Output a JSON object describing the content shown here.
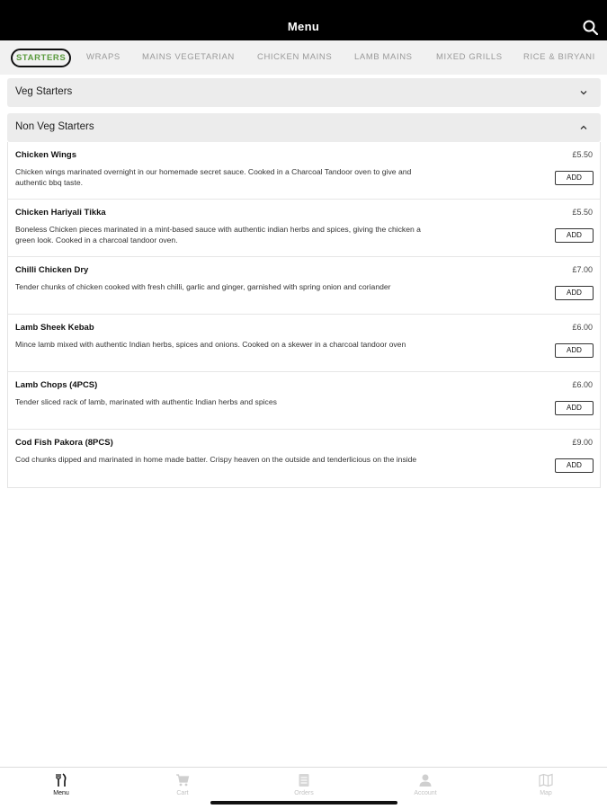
{
  "header": {
    "title": "Menu",
    "search_icon": "search-icon"
  },
  "tabs": [
    {
      "label": "STARTERS",
      "active": true
    },
    {
      "label": "WRAPS"
    },
    {
      "label": "MAINS VEGETARIAN"
    },
    {
      "label": "CHICKEN MAINS"
    },
    {
      "label": "LAMB MAINS"
    },
    {
      "label": "MIXED GRILLS"
    },
    {
      "label": "RICE & BIRYANI"
    }
  ],
  "sections": {
    "veg": {
      "label": "Veg Starters",
      "expanded": false
    },
    "nonveg": {
      "label": "Non Veg Starters",
      "expanded": true
    }
  },
  "items": [
    {
      "name": "Chicken Wings",
      "price": "£5.50",
      "desc": "Chicken wings marinated overnight in our homemade secret sauce. Cooked in a Charcoal Tandoor oven to give and authentic bbq taste.",
      "add": "ADD"
    },
    {
      "name": "Chicken Hariyali Tikka",
      "price": "£5.50",
      "desc": "Boneless Chicken pieces marinated in a mint-based sauce with authentic indian herbs and spices, giving the chicken a green look. Cooked in a charcoal tandoor oven.",
      "add": "ADD"
    },
    {
      "name": "Chilli Chicken Dry",
      "price": "£7.00",
      "desc": "Tender chunks of chicken cooked with fresh chilli, garlic and ginger, garnished with spring onion and coriander",
      "add": "ADD"
    },
    {
      "name": "Lamb Sheek Kebab",
      "price": "£6.00",
      "desc": "Mince lamb mixed with authentic Indian herbs, spices and onions. Cooked on a skewer in a charcoal tandoor oven",
      "add": "ADD"
    },
    {
      "name": "Lamb Chops (4PCS)",
      "price": "£6.00",
      "desc": "Tender sliced rack of lamb, marinated with authentic Indian herbs and spices",
      "add": "ADD"
    },
    {
      "name": "Cod Fish Pakora (8PCS)",
      "price": "£9.00",
      "desc": "Cod chunks dipped and marinated in home made batter. Crispy heaven on the outside and tenderlicious on the inside",
      "add": "ADD"
    }
  ],
  "bottom_nav": [
    {
      "label": "Menu",
      "icon": "cutlery-icon",
      "active": true
    },
    {
      "label": "Cart",
      "icon": "cart-icon"
    },
    {
      "label": "Orders",
      "icon": "orders-icon"
    },
    {
      "label": "Account",
      "icon": "person-icon"
    },
    {
      "label": "Map",
      "icon": "map-icon"
    }
  ],
  "colors": {
    "accent": "#5a9a3d",
    "header_bg": "#000000",
    "tab_bg": "#f1f1f1",
    "section_bg": "#ececec"
  }
}
